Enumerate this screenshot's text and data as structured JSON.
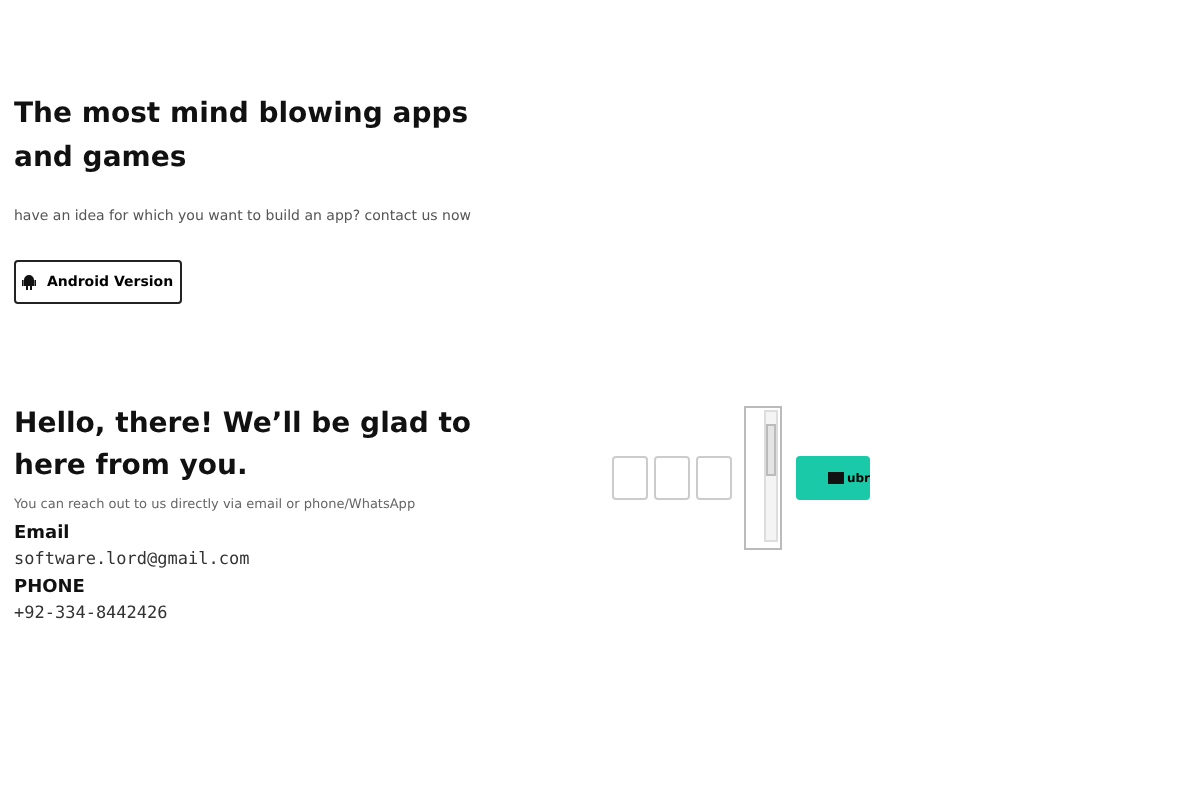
{
  "hero": {
    "title": "The most mind blowing apps and games",
    "subtitle": "have an idea for which you want to build an app? contact us now",
    "button": "Android Version"
  },
  "contact": {
    "title": "Hello, there! We’ll be glad to here from you.",
    "subtitle": "You can reach out to us directly via email or phone/WhatsApp",
    "details": [
      {
        "label": "Email",
        "value": "software.lord@gmail.com"
      },
      {
        "label": "PHONE",
        "value": "+92-334-8442426"
      }
    ]
  },
  "form": {
    "submit": "ubr"
  }
}
